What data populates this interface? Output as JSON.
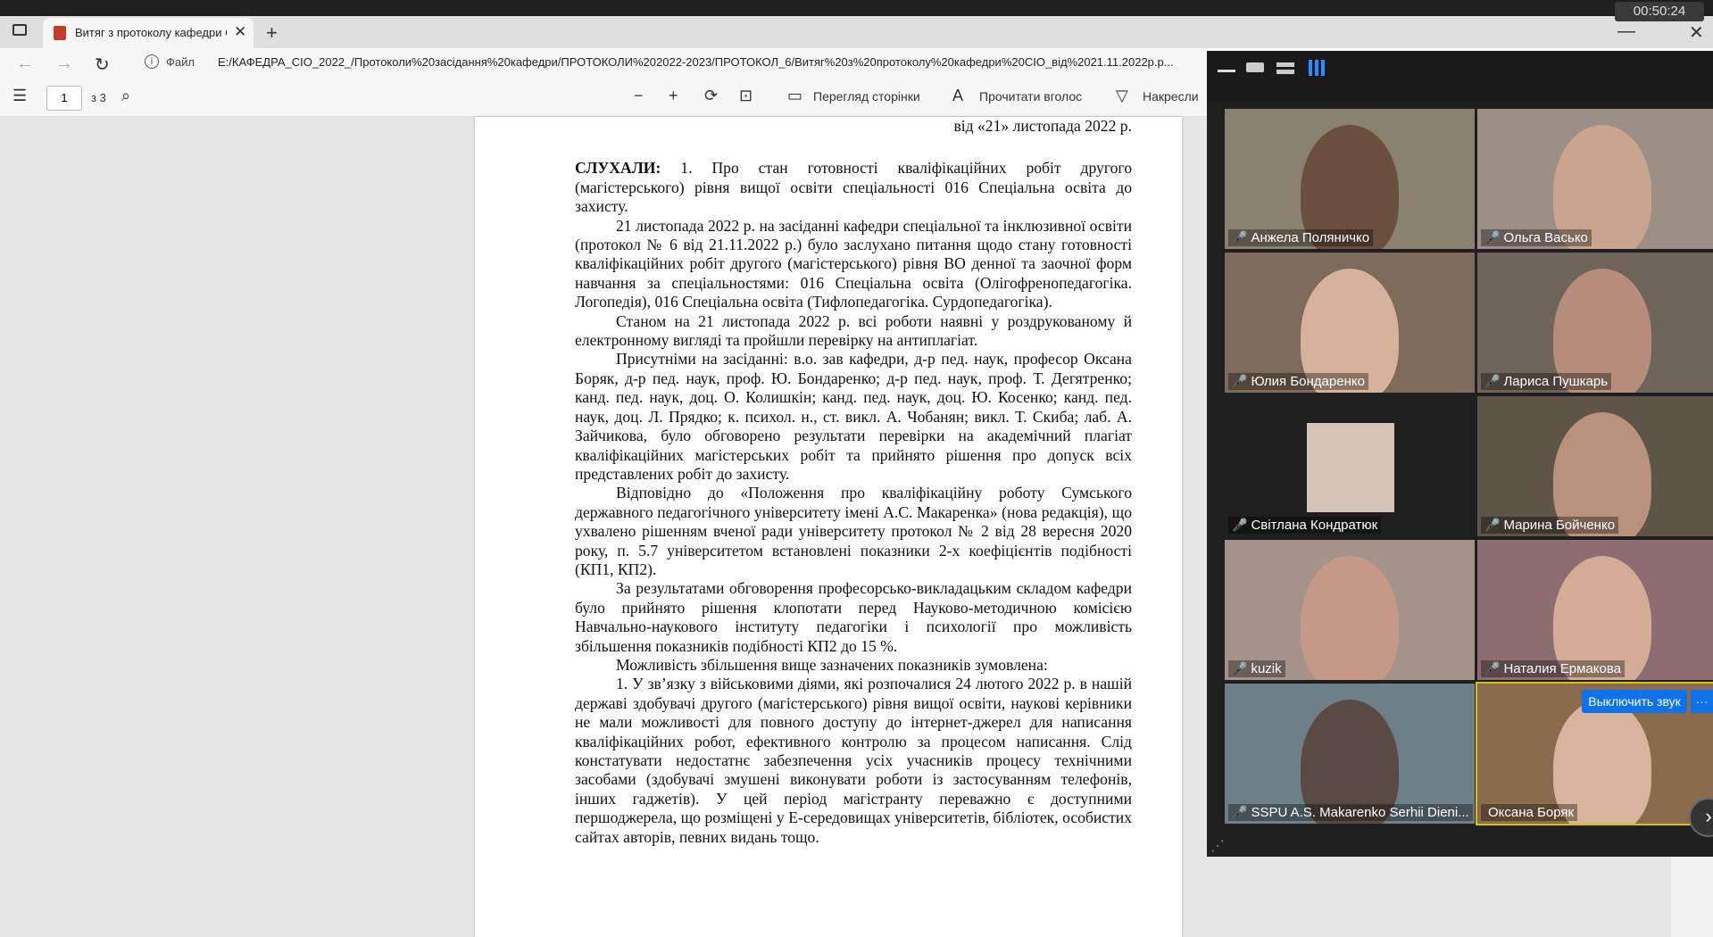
{
  "browser": {
    "timer": "00:50:24",
    "tab_title": "Витяг з протоколу кафедри СІО",
    "address_scheme": "Файл",
    "address_url": "E:/КАФЕДРА_СІО_2022_/Протоколи%20засідання%20кафедри/ПРОТОКОЛИ%202022-2023/ПРОТОКОЛ_6/Витяг%20з%20протоколу%20кафедри%20СІО_від%2021.11.2022p.p..."
  },
  "pdf_toolbar": {
    "page_number": "1",
    "page_total": "з 3",
    "page_view_label": "Перегляд сторінки",
    "read_aloud_label": "Прочитати вголос",
    "draw_label": "Накресли"
  },
  "document": {
    "date_line": "від «21» листопада 2022 р.",
    "heard_label": "СЛУХАЛИ:",
    "p1": "1. Про стан готовності кваліфікаційних робіт другого (магістерського) рівня вищої освіти спеціальності 016 Спеціальна освіта до захисту.",
    "p2": "21 листопада 2022 р. на засіданні кафедри спеціальної та інклюзивної освіти (протокол № 6 від 21.11.2022 р.) було заслухано питання щодо стану готовності кваліфікаційних робіт другого (магістерського) рівня ВО денної та заочної форм навчання за спеціальностями: 016 Спеціальна освіта (Олігофренопедагогіка. Логопедія), 016 Спеціальна освіта (Тифлопедагогіка. Сурдопедагогіка).",
    "p3": "Станом на 21 листопада 2022 р. всі роботи наявні у роздрукованому й електронному вигляді та пройшли перевірку на антиплагіат.",
    "p4": "Присутніми на засіданні: в.о. зав кафедри, д-р пед. наук, професор Оксана Боряк, д-р пед. наук, проф. Ю. Бондаренко; д-р пед. наук, проф. Т. Дегятренко; канд. пед. наук, доц. О. Колишкін; канд. пед. наук, доц. Ю. Косенко; канд. пед. наук, доц. Л. Прядко; к. психол. н., ст. викл. А. Чобанян; викл. Т. Скиба; лаб. А. Зайчикова, було обговорено результати перевірки на академічний плагіат кваліфікаційних магістерських робіт та прийнято рішення про допуск всіх представлених робіт до захисту.",
    "p5": "Відповідно до «Положення про кваліфікаційну роботу Сумського державного педагогічного університету імені А.С. Макаренка» (нова редакція), що ухвалено рішенням вченої ради університету протокол № 2 від 28 вересня 2020 року, п. 5.7 університетом встановлені показники 2-х коефіцієнтів подібності (КП1, КП2).",
    "p6": "За результатами обговорення професорсько-викладацьким складом кафедри було прийнято рішення клопотати перед Науково-методичною комісією Навчально-наукового інституту педагогіки і психології про можливість збільшення показників подібності КП2 до 15 %.",
    "p7": "Можливість збільшення вище зазначених показників зумовлена:",
    "p8": "1.      У зв’язку з військовими діями, які розпочалися 24 лютого 2022 р. в нашій державі здобувачі другого (магістерського) рівня вищої освіти, наукові керівники не мали можливості для повного доступу до інтернет-джерел для написання кваліфікаційних робот, ефективного контролю за процесом написання. Слід констатувати недостатнє забезпечення усіх учасників процесу технічними засобами (здобувачі змушені виконувати роботи із застосуванням телефонів, інших гаджетів). У цей період магістранту переважно є доступними першоджерела, що розміщені у Е-середовищах університетів, бібліотек, особистих сайтах авторів, певних видань тощо."
  },
  "zoom": {
    "unmute_label": "Выключить звук",
    "more_label": "···",
    "participants": [
      {
        "name": "Анжела Поляничко"
      },
      {
        "name": "Ольга Васько"
      },
      {
        "name": "Юлия Бондаренко"
      },
      {
        "name": "Лариса Пушкарь"
      },
      {
        "name": "Світлана Кондратюк"
      },
      {
        "name": "Марина Бойченко"
      },
      {
        "name": "kuzik"
      },
      {
        "name": "Наталия Ермакова"
      },
      {
        "name": "SSPU A.S. Makarenko Serhii Dieni..."
      },
      {
        "name": "Оксана Боряк"
      }
    ]
  }
}
